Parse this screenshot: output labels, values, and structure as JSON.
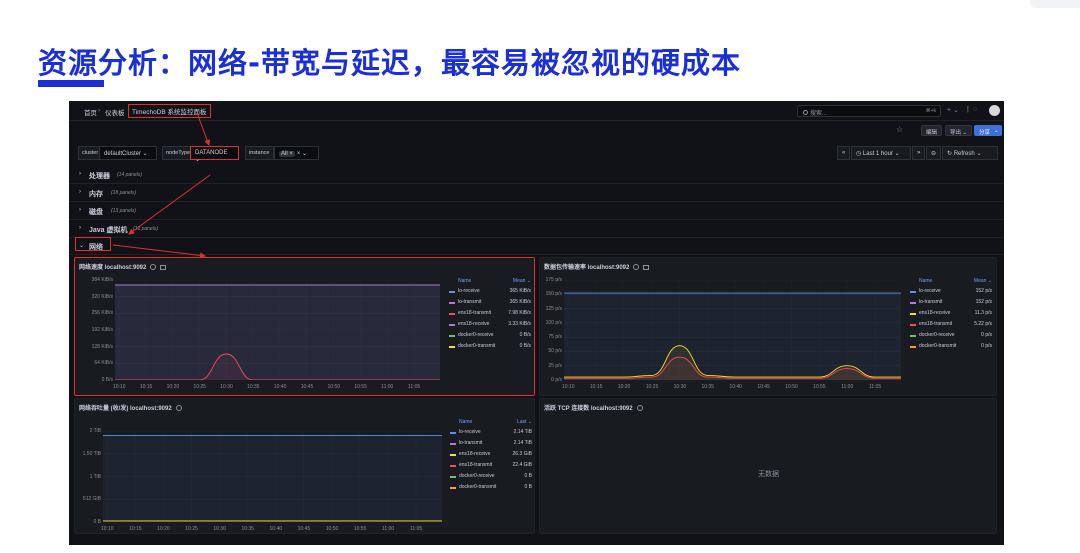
{
  "slide": {
    "title": "资源分析：网络-带宽与延迟，最容易被忽视的硬成本",
    "accent_color": "#1b2fd6"
  },
  "grafana": {
    "breadcrumb": [
      "首页",
      "仪表板",
      "TimechoDB 系统监控面板"
    ],
    "breadcrumb_sep": "›",
    "search_placeholder": "搜索...",
    "search_shortcut": "⌘+k",
    "edit_label": "编辑",
    "export_label": "导出 ⌄",
    "share_label": "分享",
    "variables": [
      {
        "label": "cluster",
        "value": "defaultCluster ⌄"
      },
      {
        "label": "nodeType",
        "value": "DATANODE ⌄"
      },
      {
        "label": "instance",
        "chip": "All ×",
        "value": "× ⌄"
      }
    ],
    "time_range": "Last 1 hour ⌄",
    "zoom_prev": "«",
    "zoom_next": "»",
    "refresh": "Refresh ⌄",
    "rows": [
      {
        "title": "处理器",
        "count": "(14 panels)",
        "collapsed": true
      },
      {
        "title": "内存",
        "count": "(18 panels)",
        "collapsed": true
      },
      {
        "title": "磁盘",
        "count": "(13 panels)",
        "collapsed": true
      },
      {
        "title": "Java 虚拟机",
        "count": "(12 panels)",
        "collapsed": true
      },
      {
        "title": "网络",
        "count": "",
        "collapsed": false
      }
    ],
    "panels": {
      "net_speed": {
        "title": "网络速度 localhost:9092",
        "legend_name": "Name",
        "legend_stat": "Mean ⌄",
        "yticks": [
          "384 KiB/s",
          "320 KiB/s",
          "256 KiB/s",
          "192 KiB/s",
          "128 KiB/s",
          "64 KiB/s",
          "0 B/s"
        ],
        "legend": [
          {
            "name": "lo-receive",
            "value": "365 KiB/s",
            "color": "#5794f2"
          },
          {
            "name": "lo-transmit",
            "value": "365 KiB/s",
            "color": "#b877d9"
          },
          {
            "name": "ens18-transmit",
            "value": "7.98 KiB/s",
            "color": "#f2495c"
          },
          {
            "name": "ens18-receive",
            "value": "3.33 KiB/s",
            "color": "#b877d9"
          },
          {
            "name": "docker0-receive",
            "value": "0 B/s",
            "color": "#73bf69"
          },
          {
            "name": "docker0-transmit",
            "value": "0 B/s",
            "color": "#fade2a"
          }
        ]
      },
      "pkt_rate": {
        "title": "数据包传输速率 localhost:9092",
        "legend_name": "Name",
        "legend_stat": "Mean ⌄",
        "yticks": [
          "175 p/s",
          "150 p/s",
          "125 p/s",
          "100 p/s",
          "75 p/s",
          "50 p/s",
          "25 p/s",
          "0 p/s"
        ],
        "legend": [
          {
            "name": "lo-receive",
            "value": "152 p/s",
            "color": "#5794f2"
          },
          {
            "name": "lo-transmit",
            "value": "152 p/s",
            "color": "#b877d9"
          },
          {
            "name": "ens18-receive",
            "value": "11.3 p/s",
            "color": "#fade2a"
          },
          {
            "name": "ens18-transmit",
            "value": "5.22 p/s",
            "color": "#f2495c"
          },
          {
            "name": "docker0-receive",
            "value": "0 p/s",
            "color": "#73bf69"
          },
          {
            "name": "docker0-transmit",
            "value": "0 p/s",
            "color": "#ff9830"
          }
        ]
      },
      "throughput": {
        "title": "网络吞吐量 (收/发) localhost:9092",
        "legend_name": "Name",
        "legend_stat": "Last ⌄",
        "yticks": [
          "2 TiB",
          "1.50 TiB",
          "1 TiB",
          "512 GiB",
          "0 B"
        ],
        "legend": [
          {
            "name": "lo-receive",
            "value": "2.14 TiB",
            "color": "#5794f2"
          },
          {
            "name": "lo-transmit",
            "value": "2.14 TiB",
            "color": "#b877d9"
          },
          {
            "name": "ens18-receive",
            "value": "26.3 GiB",
            "color": "#fade2a"
          },
          {
            "name": "ens18-transmit",
            "value": "22.4 GiB",
            "color": "#f2495c"
          },
          {
            "name": "docker0-receive",
            "value": "0 B",
            "color": "#73bf69"
          },
          {
            "name": "docker0-transmit",
            "value": "0 B",
            "color": "#ff9830"
          }
        ]
      },
      "tcp": {
        "title": "活跃 TCP 连接数 localhost:9092",
        "no_data": "无数据"
      }
    },
    "xticks": [
      "10:10",
      "10:15",
      "10:20",
      "10:25",
      "10:30",
      "10:35",
      "10:40",
      "10:45",
      "10:50",
      "10:55",
      "11:00",
      "11:05"
    ]
  },
  "chart_data": [
    {
      "type": "line",
      "title": "网络速度 localhost:9092",
      "x": [
        "10:10",
        "10:15",
        "10:20",
        "10:25",
        "10:30",
        "10:35",
        "10:40",
        "10:45",
        "10:50",
        "10:55",
        "11:00",
        "11:05"
      ],
      "ylim": [
        0,
        384
      ],
      "series": [
        {
          "name": "lo-receive",
          "values": [
            365,
            365,
            365,
            365,
            365,
            365,
            365,
            365,
            365,
            365,
            365,
            365
          ]
        },
        {
          "name": "lo-transmit",
          "values": [
            365,
            365,
            365,
            365,
            365,
            365,
            365,
            365,
            365,
            365,
            365,
            365
          ]
        },
        {
          "name": "ens18-transmit",
          "values": [
            0,
            0,
            0,
            0,
            100,
            0,
            0,
            0,
            0,
            0,
            0,
            0
          ]
        }
      ]
    },
    {
      "type": "line",
      "title": "数据包传输速率 localhost:9092",
      "x": [
        "10:10",
        "10:15",
        "10:20",
        "10:25",
        "10:30",
        "10:35",
        "10:40",
        "10:45",
        "10:50",
        "10:55",
        "11:00",
        "11:05"
      ],
      "ylim": [
        0,
        175
      ],
      "series": [
        {
          "name": "lo-receive",
          "values": [
            152,
            152,
            152,
            152,
            152,
            152,
            152,
            152,
            152,
            152,
            152,
            152
          ]
        },
        {
          "name": "ens18-receive",
          "values": [
            5,
            5,
            5,
            8,
            60,
            8,
            5,
            5,
            5,
            5,
            25,
            5
          ]
        },
        {
          "name": "ens18-transmit",
          "values": [
            3,
            3,
            3,
            5,
            40,
            5,
            3,
            3,
            3,
            3,
            20,
            3
          ]
        }
      ]
    },
    {
      "type": "line",
      "title": "网络吞吐量 (收/发) localhost:9092",
      "x": [
        "10:10",
        "10:15",
        "10:20",
        "10:25",
        "10:30",
        "10:35",
        "10:40",
        "10:45",
        "10:50",
        "10:55",
        "11:00",
        "11:05"
      ],
      "ylim": [
        0,
        2.25
      ],
      "series": [
        {
          "name": "lo-receive",
          "values": [
            2.14,
            2.14,
            2.14,
            2.14,
            2.14,
            2.14,
            2.14,
            2.14,
            2.14,
            2.14,
            2.14,
            2.14
          ]
        },
        {
          "name": "ens18-receive",
          "values": [
            0.026,
            0.026,
            0.026,
            0.026,
            0.026,
            0.026,
            0.026,
            0.026,
            0.026,
            0.026,
            0.026,
            0.026
          ]
        }
      ]
    }
  ]
}
